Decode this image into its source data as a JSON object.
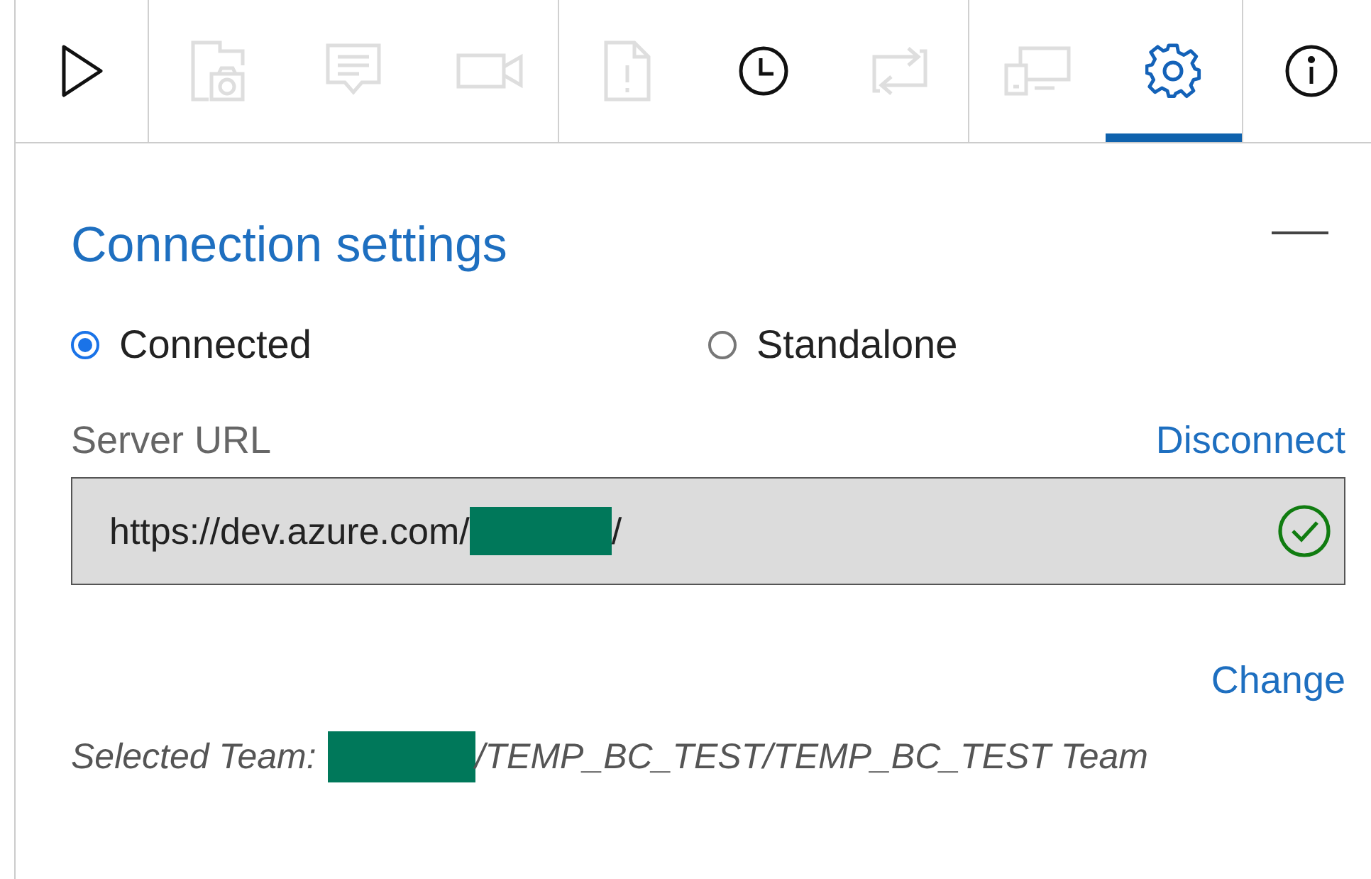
{
  "toolbar": [
    {
      "buttons": [
        {
          "kind": "play",
          "disabled": false,
          "selected": false
        }
      ]
    },
    {
      "buttons": [
        {
          "kind": "camera-doc",
          "disabled": true,
          "selected": false
        },
        {
          "kind": "comment",
          "disabled": true,
          "selected": false
        },
        {
          "kind": "video",
          "disabled": true,
          "selected": false
        }
      ]
    },
    {
      "buttons": [
        {
          "kind": "doc-alert",
          "disabled": true,
          "selected": false
        },
        {
          "kind": "clock",
          "disabled": false,
          "selected": false
        },
        {
          "kind": "repeat",
          "disabled": true,
          "selected": false
        }
      ]
    },
    {
      "buttons": [
        {
          "kind": "devices",
          "disabled": true,
          "selected": false
        },
        {
          "kind": "gear",
          "disabled": false,
          "selected": true
        }
      ]
    },
    {
      "buttons": [
        {
          "kind": "info",
          "disabled": false,
          "selected": false
        }
      ]
    }
  ],
  "panel": {
    "title": "Connection settings",
    "modes": [
      {
        "label": "Connected",
        "selected": true
      },
      {
        "label": "Standalone",
        "selected": false
      }
    ],
    "server_url": {
      "label": "Server URL",
      "link": "Disconnect",
      "value_before": "https://dev.azure.com/",
      "redacted": true,
      "value_after": "/",
      "verified": true
    },
    "change_link": "Change",
    "team": {
      "label": "Selected Team:",
      "redacted": true,
      "value": "/TEMP_BC_TEST/TEMP_BC_TEST Team"
    }
  }
}
